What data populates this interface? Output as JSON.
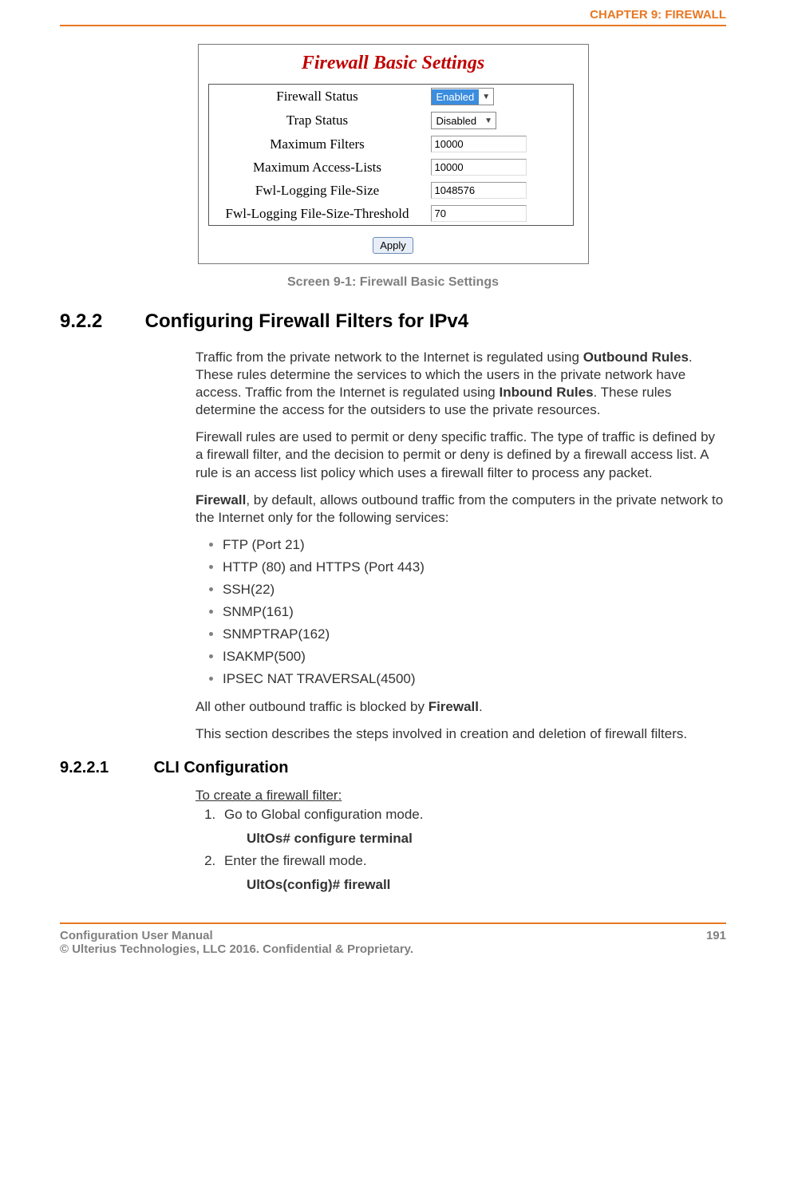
{
  "header": {
    "chapter": "CHAPTER 9: FIREWALL"
  },
  "figure": {
    "title": "Firewall Basic Settings",
    "rows": [
      {
        "label": "Firewall Status",
        "type": "dropdown",
        "value": "Enabled",
        "enabled_style": true
      },
      {
        "label": "Trap Status",
        "type": "dropdown",
        "value": "Disabled",
        "enabled_style": false
      },
      {
        "label": "Maximum Filters",
        "type": "input",
        "value": "10000"
      },
      {
        "label": "Maximum Access-Lists",
        "type": "input",
        "value": "10000"
      },
      {
        "label": "Fwl-Logging File-Size",
        "type": "input",
        "value": "1048576"
      },
      {
        "label": "Fwl-Logging File-Size-Threshold",
        "type": "input",
        "value": "70"
      }
    ],
    "apply": "Apply",
    "caption": "Screen 9-1: Firewall Basic Settings"
  },
  "section": {
    "number": "9.2.2",
    "title": "Configuring Firewall Filters for IPv4"
  },
  "body": {
    "p1a": "Traffic from the private network to the Internet is regulated using ",
    "p1b": "Outbound Rules",
    "p1c": ". These rules determine the services to which the users in the private network have access. Traffic from the Internet is regulated using ",
    "p1d": "Inbound Rules",
    "p1e": ". These rules determine the access for the outsiders to use the private resources.",
    "p2": "Firewall rules are used to permit or deny specific traffic. The type of traffic is defined by a firewall filter, and the decision to permit or deny is defined by a firewall access list. A rule is an access list policy which uses a firewall filter to process any packet.",
    "p3a": "Firewall",
    "p3b": ", by default, allows outbound traffic from the computers in the private network to the Internet only for the following services:",
    "bullets": [
      "FTP (Port 21)",
      "HTTP (80) and HTTPS (Port 443)",
      "SSH(22)",
      "SNMP(161)",
      "SNMPTRAP(162)",
      "ISAKMP(500)",
      "IPSEC NAT TRAVERSAL(4500)"
    ],
    "p4a": "All other outbound traffic is blocked by ",
    "p4b": "Firewall",
    "p4c": ".",
    "p5": "This section describes the steps involved in creation and deletion of firewall filters."
  },
  "subsection": {
    "number": "9.2.2.1",
    "title": "CLI Configuration",
    "intro": "To create a firewall filter:",
    "steps": [
      {
        "text": "Go to Global configuration mode.",
        "cmd": "UltOs# configure terminal"
      },
      {
        "text": "Enter the firewall mode.",
        "cmd": "UltOs(config)# firewall"
      }
    ]
  },
  "footer": {
    "left1": "Configuration User Manual",
    "left2": "© Ulterius Technologies, LLC 2016. Confidential & Proprietary.",
    "page": "191"
  }
}
